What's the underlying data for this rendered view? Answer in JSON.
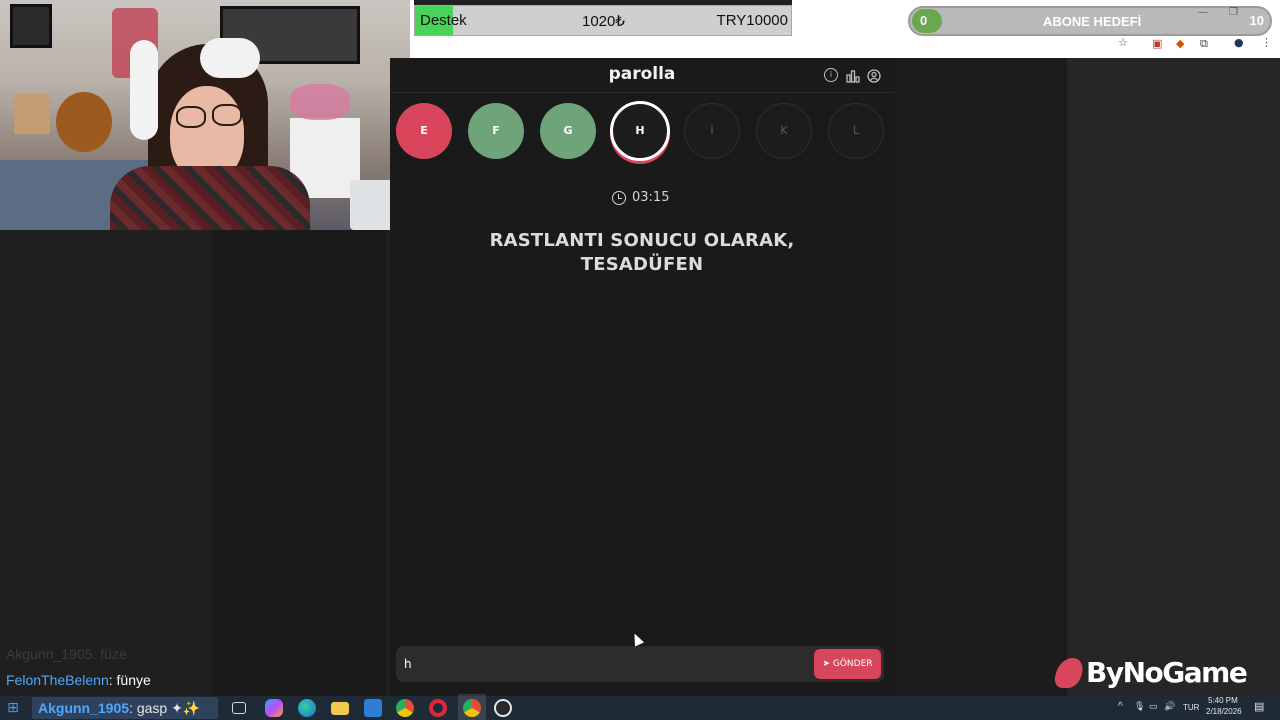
{
  "overlay": {
    "destek_label": "Destek",
    "destek_current": "1020₺",
    "destek_target": "TRY10000",
    "destek_progress_fraction": 0.102,
    "abone_current": "0",
    "abone_label": "ABONE HEDEFİ",
    "abone_target": "10"
  },
  "game": {
    "title": "parolla",
    "header_icons": [
      "info-icon",
      "stats-icon",
      "profile-icon"
    ],
    "letters": [
      {
        "letter": "E",
        "state": "wrong"
      },
      {
        "letter": "F",
        "state": "correct"
      },
      {
        "letter": "G",
        "state": "correct"
      },
      {
        "letter": "H",
        "state": "current"
      },
      {
        "letter": "İ",
        "state": "pending"
      },
      {
        "letter": "K",
        "state": "pending"
      },
      {
        "letter": "L",
        "state": "pending"
      }
    ],
    "timer": "03:15",
    "clue_line1": "RASTLANTI SONUCU OLARAK,",
    "clue_line2": "TESADÜFEN",
    "answer_value": "h",
    "send_label": "GÖNDER"
  },
  "chat": {
    "faded_user": "Akgunn_1905",
    "faded_msg": ": füze",
    "user": "FelonTheBelenn",
    "msg": ": fünye",
    "taskbar_user": "Akgunn_1905",
    "taskbar_msg": ": gasp ✦✨"
  },
  "brand": {
    "name": "ByNoGame"
  },
  "taskbar": {
    "icons": [
      "start-icon",
      "task-view-icon",
      "copilot-icon",
      "edge-icon",
      "file-explorer-icon",
      "store-icon",
      "chrome-icon",
      "opera-icon",
      "chrome-active-icon",
      "obs-icon"
    ],
    "language": "TUR",
    "time": "5:40 PM",
    "date": "2/18/2026"
  },
  "colors": {
    "wrong": "#d9465c",
    "correct": "#6fa47b",
    "destek_fill": "#49d35a",
    "abone_fill": "#6aa84f"
  }
}
